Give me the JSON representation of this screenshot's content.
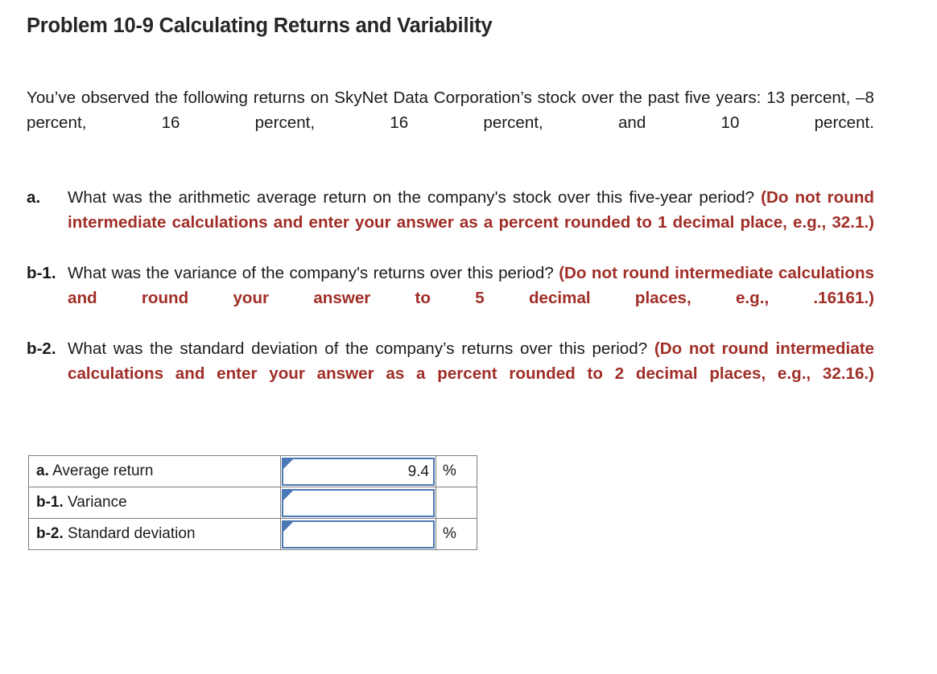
{
  "title": "Problem 10-9 Calculating Returns and Variability",
  "intro": "You’ve observed the following returns on SkyNet Data Corporation’s stock over the past five years: 13 percent, –8 percent, 16 percent, 16 percent, and 10 percent.",
  "questions": [
    {
      "label": "a.",
      "text": "What was the arithmetic average return on the company's stock over this five-year period? ",
      "hint": "(Do not round intermediate calculations and enter your answer as a percent rounded to 1 decimal place, e.g., 32.1.)"
    },
    {
      "label": "b-1.",
      "text": "What was the variance of the company's returns over this period? ",
      "hint": "(Do not round intermediate calculations and round your answer to 5 decimal places, e.g., .16161.)"
    },
    {
      "label": "b-2.",
      "text": "What was the standard deviation of the company’s returns over this period? ",
      "hint": "(Do not round intermediate calculations and enter your answer as a percent rounded to 2 decimal places, e.g., 32.16.)"
    }
  ],
  "answer_table": {
    "rows": [
      {
        "label_prefix": "a.",
        "label_text": " Average return",
        "value": "9.4",
        "placeholder": "",
        "unit": "%"
      },
      {
        "label_prefix": "b-1.",
        "label_text": " Variance",
        "value": "",
        "placeholder": "",
        "unit": ""
      },
      {
        "label_prefix": "b-2.",
        "label_text": " Standard deviation",
        "value": "",
        "placeholder": "",
        "unit": "%"
      }
    ]
  },
  "colors": {
    "hint_red": "#a02e27",
    "input_border_blue": "#4a78b4",
    "table_border_gray": "#7f7f7f",
    "text": "#1b1b1b"
  }
}
